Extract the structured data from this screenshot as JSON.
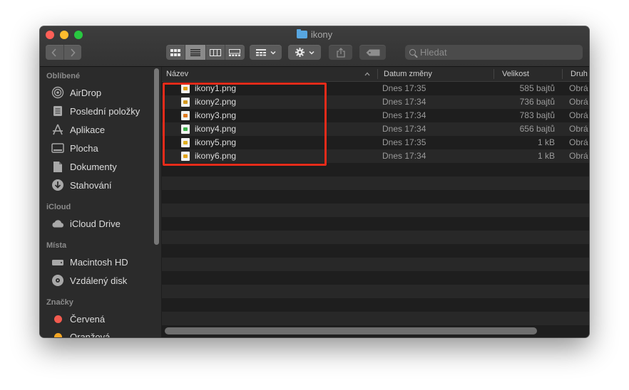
{
  "window": {
    "title": "ikony"
  },
  "toolbar": {
    "back_icon": "chevron-left-icon",
    "forward_icon": "chevron-right-icon",
    "view_modes": [
      "icons",
      "list",
      "columns",
      "gallery"
    ],
    "active_view": "list",
    "search": {
      "placeholder": "Hledat"
    }
  },
  "sidebar": {
    "sections": [
      {
        "heading": "Oblíbené",
        "items": [
          {
            "label": "AirDrop",
            "icon": "airdrop-icon"
          },
          {
            "label": "Poslední položky",
            "icon": "recents-icon"
          },
          {
            "label": "Aplikace",
            "icon": "applications-icon"
          },
          {
            "label": "Plocha",
            "icon": "desktop-icon"
          },
          {
            "label": "Dokumenty",
            "icon": "documents-icon"
          },
          {
            "label": "Stahování",
            "icon": "downloads-icon"
          }
        ]
      },
      {
        "heading": "iCloud",
        "items": [
          {
            "label": "iCloud Drive",
            "icon": "cloud-icon"
          }
        ]
      },
      {
        "heading": "Místa",
        "items": [
          {
            "label": "Macintosh HD",
            "icon": "harddisk-icon"
          },
          {
            "label": "Vzdálený disk",
            "icon": "remote-disk-icon"
          }
        ]
      },
      {
        "heading": "Značky",
        "items": [
          {
            "label": "Červená",
            "color": "#f25b4f"
          },
          {
            "label": "Oranžová",
            "color": "#f5a623"
          }
        ]
      }
    ]
  },
  "list": {
    "columns": {
      "name": "Název",
      "date": "Datum změny",
      "size": "Velikost",
      "kind": "Druh"
    },
    "files": [
      {
        "name": "ikony1.png",
        "date": "Dnes 17:35",
        "size": "585 bajtů",
        "kind": "Obrá",
        "thumb": "#e0a21a"
      },
      {
        "name": "ikony2.png",
        "date": "Dnes 17:34",
        "size": "736 bajtů",
        "kind": "Obrá",
        "thumb": "#d49a20"
      },
      {
        "name": "ikony3.png",
        "date": "Dnes 17:34",
        "size": "783 bajtů",
        "kind": "Obrá",
        "thumb": "#e07a20"
      },
      {
        "name": "ikony4.png",
        "date": "Dnes 17:34",
        "size": "656 bajtů",
        "kind": "Obrá",
        "thumb": "#3cb04a"
      },
      {
        "name": "ikony5.png",
        "date": "Dnes 17:35",
        "size": "1 kB",
        "kind": "Obrá",
        "thumb": "#e0b020"
      },
      {
        "name": "ikony6.png",
        "date": "Dnes 17:34",
        "size": "1 kB",
        "kind": "Obrá",
        "thumb": "#e2a41c"
      }
    ],
    "highlight_color": "#e52b1a"
  }
}
